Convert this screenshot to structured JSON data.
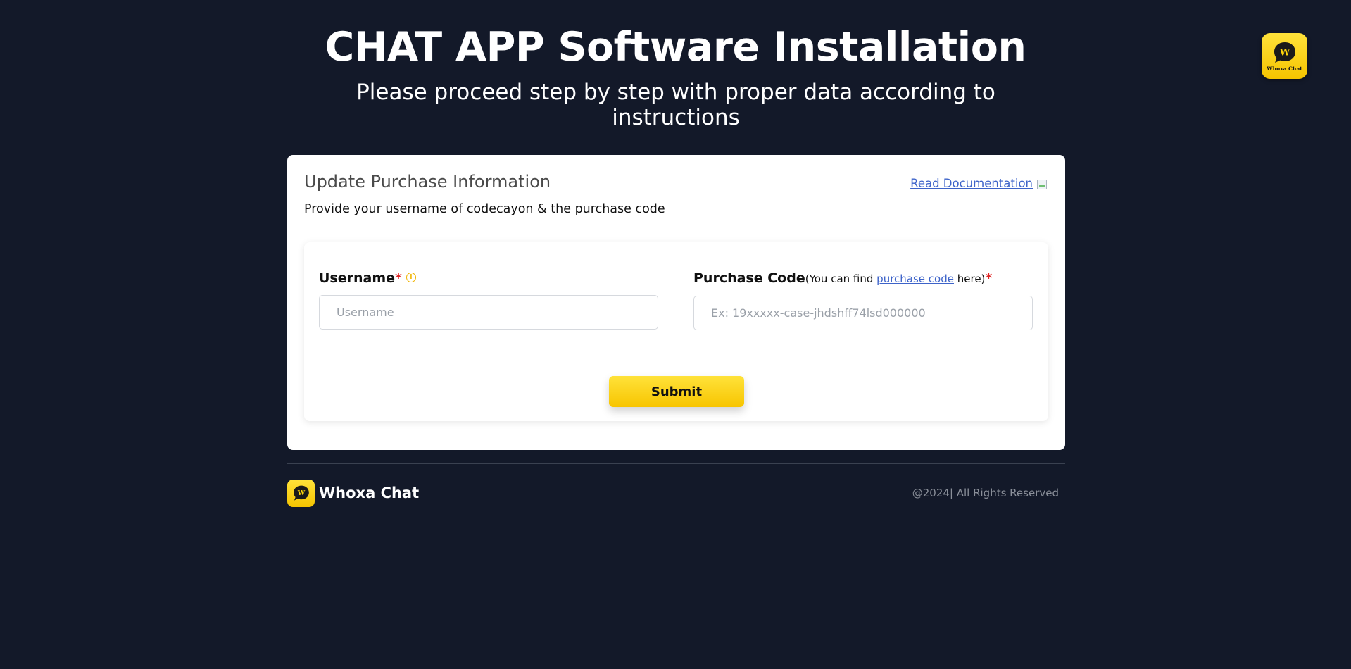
{
  "header": {
    "title": "CHAT APP Software Installation",
    "subtitle": "Please proceed step by step with proper data according to instructions"
  },
  "app_logo": {
    "text": "Whoxa Chat",
    "letter": "W"
  },
  "card": {
    "title": "Update Purchase Information",
    "description": "Provide your username of codecayon & the purchase code",
    "doc_link": "Read Documentation",
    "doc_icon": "image-icon"
  },
  "form": {
    "username": {
      "label": "Username",
      "required_mark": "*",
      "info_icon": "info-icon",
      "placeholder": "Username",
      "value": ""
    },
    "purchase_code": {
      "label": "Purchase Code",
      "hint_prefix": "(You can find ",
      "hint_link": "purchase code",
      "hint_suffix": " here)",
      "required_mark": "*",
      "placeholder": "Ex: 19xxxxx-case-jhdshff74lsd000000",
      "value": ""
    },
    "submit_label": "Submit"
  },
  "footer": {
    "brand": "Whoxa Chat",
    "logo_letter": "W",
    "copyright": "@2024| All Rights Reserved"
  },
  "colors": {
    "background": "#131929",
    "accent": "#ffd60a",
    "link": "#3d63c9",
    "required": "#e02424"
  }
}
